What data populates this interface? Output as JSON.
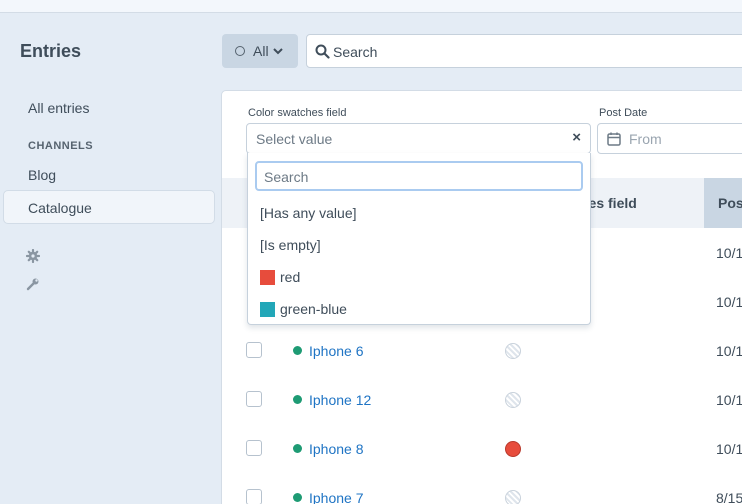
{
  "sidebar": {
    "title": "Entries",
    "all_entries": "All entries",
    "channels_heading": "CHANNELS",
    "channels": [
      "Blog",
      "Catalogue"
    ]
  },
  "toolbar": {
    "status_label": "All",
    "search_placeholder": "Search"
  },
  "filters": {
    "color_field_label": "Color swatches field",
    "color_field_placeholder": "Select value",
    "post_date_label": "Post Date",
    "post_date_placeholder": "From"
  },
  "dropdown": {
    "search_placeholder": "Search",
    "options": [
      {
        "label": "[Has any value]"
      },
      {
        "label": "[Is empty]"
      },
      {
        "label": "red",
        "color": "#e74c3c"
      },
      {
        "label": "green-blue",
        "color": "#22a7b8"
      }
    ]
  },
  "table": {
    "columns": [
      "nes field",
      "Pos"
    ],
    "rows": [
      {
        "title": "",
        "swatch": "",
        "date": "10/1"
      },
      {
        "title": "",
        "swatch": "",
        "date": "10/1"
      },
      {
        "title": "Iphone 6",
        "swatch": "empty",
        "date": "10/1"
      },
      {
        "title": "Iphone 12",
        "swatch": "empty",
        "date": "10/1"
      },
      {
        "title": "Iphone 8",
        "swatch": "red",
        "swatch_color": "#e74c3c",
        "date": "10/1"
      },
      {
        "title": "Iphone 7",
        "swatch": "empty",
        "date": "8/15"
      }
    ]
  },
  "colors": {
    "background": "#e4ecf5",
    "link": "#1f74c4",
    "status_live": "#1e9b74",
    "focus_ring": "#aacbf0"
  },
  "icons": [
    "circle-icon",
    "chevron-down-icon",
    "search-icon",
    "gear-icon",
    "wrench-icon",
    "calendar-icon",
    "clear-icon"
  ]
}
